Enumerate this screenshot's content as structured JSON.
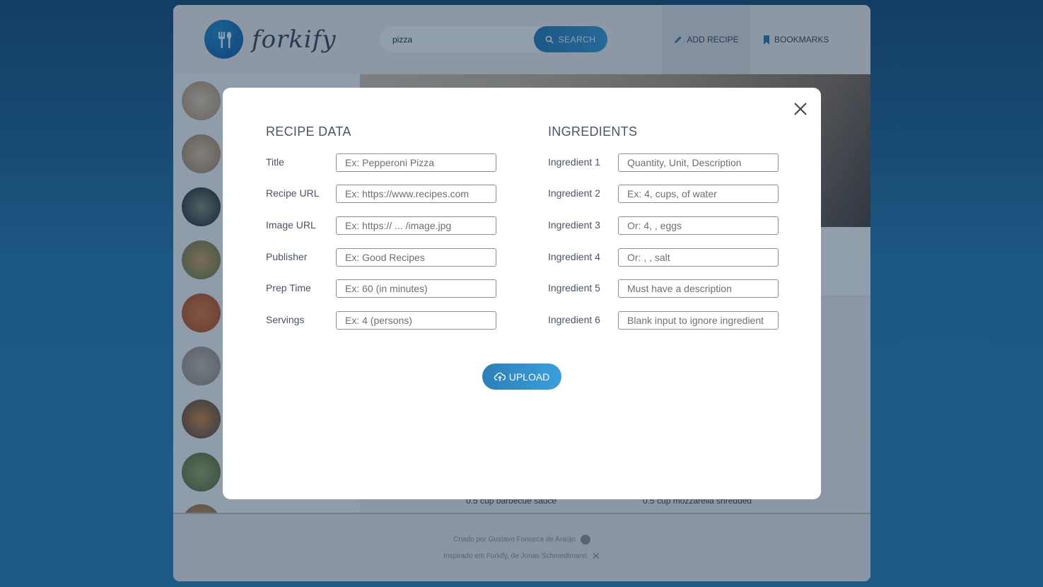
{
  "header": {
    "logo_text": "forkify",
    "search": {
      "value": "pizza",
      "button_label": "SEARCH"
    },
    "nav": {
      "add_recipe": "ADD RECIPE",
      "bookmarks": "BOOKMARKS"
    }
  },
  "footer": {
    "line1": "Criado por Gustavo Fonseca de Araújo",
    "line2": "Inspirado em Forkify, de Jonas Schmedtmann",
    "ingredient_left": "0.5 cup barbecue sauce",
    "ingredient_right": "0.5 cup mozzarella shredded"
  },
  "modal": {
    "recipe_title": "RECIPE DATA",
    "ingredients_title": "INGREDIENTS",
    "recipe_fields": [
      {
        "label": "Title",
        "placeholder": "Ex: Pepperoni Pizza"
      },
      {
        "label": "Recipe URL",
        "placeholder": "Ex: https://www.recipes.com"
      },
      {
        "label": "Image URL",
        "placeholder": "Ex: https:// ... /image.jpg"
      },
      {
        "label": "Publisher",
        "placeholder": "Ex: Good Recipes"
      },
      {
        "label": "Prep Time",
        "placeholder": "Ex: 60 (in minutes)"
      },
      {
        "label": "Servings",
        "placeholder": "Ex: 4 (persons)"
      }
    ],
    "ingredient_fields": [
      {
        "label": "Ingredient 1",
        "placeholder": "Quantity, Unit, Description"
      },
      {
        "label": "Ingredient 2",
        "placeholder": "Ex: 4, cups, of water"
      },
      {
        "label": "Ingredient 3",
        "placeholder": "Or: 4, , eggs"
      },
      {
        "label": "Ingredient 4",
        "placeholder": "Or: , , salt"
      },
      {
        "label": "Ingredient 5",
        "placeholder": "Must have a description"
      },
      {
        "label": "Ingredient 6",
        "placeholder": "Blank input to ignore ingredient"
      }
    ],
    "upload_label": "UPLOAD"
  },
  "colors": {
    "accent": "#2c7fb8",
    "text": "#4a5466",
    "background": "#2a7fb4"
  }
}
